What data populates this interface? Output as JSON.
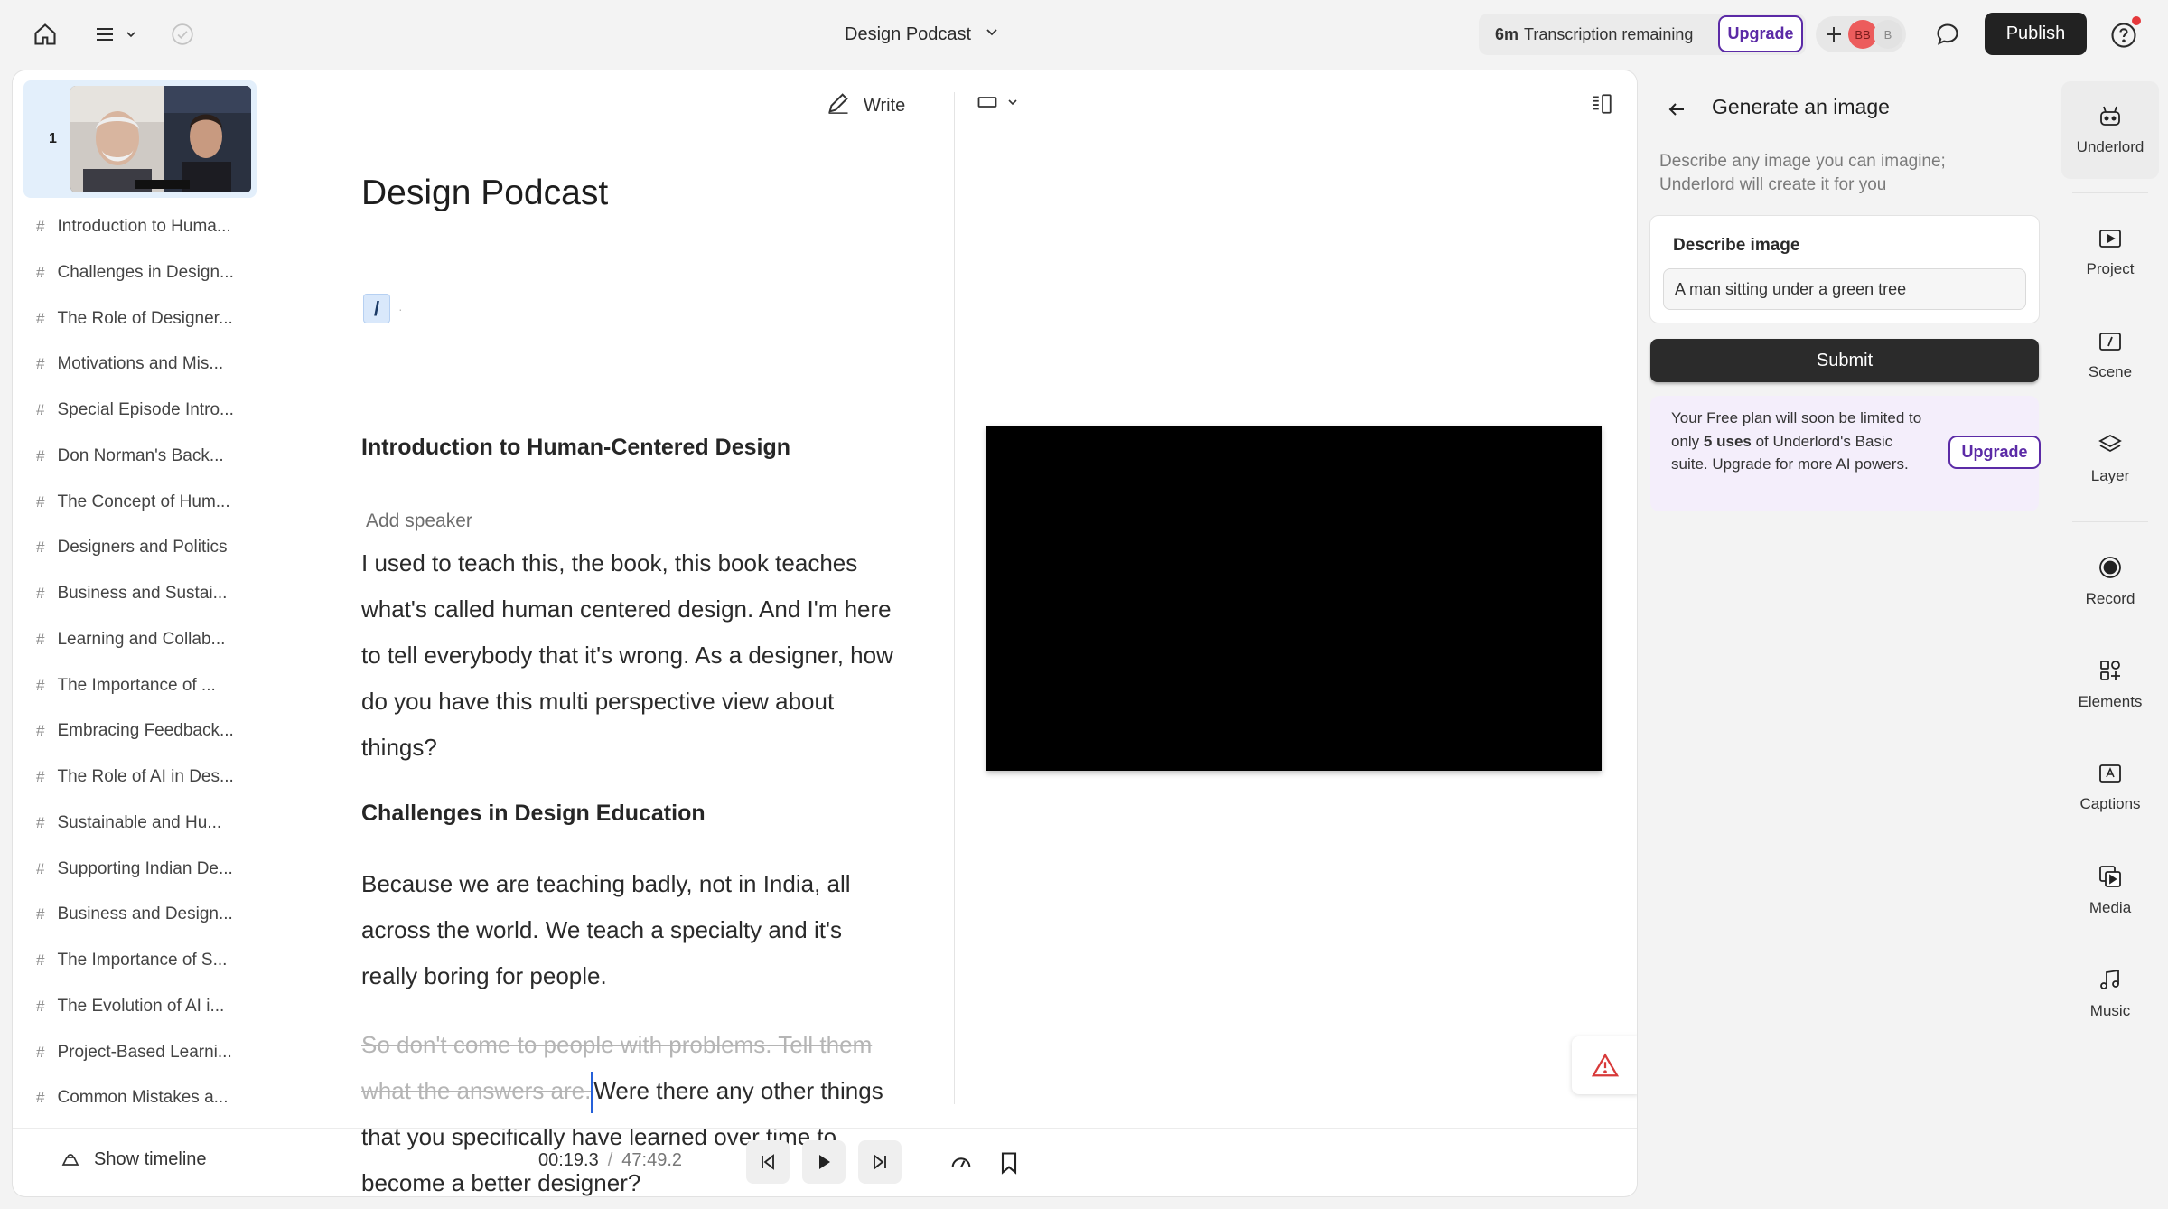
{
  "topbar": {
    "doc_title": "Design Podcast",
    "transcription_amount": "6m",
    "transcription_label": "Transcription remaining",
    "upgrade_label": "Upgrade",
    "avatar_initials_1": "BB",
    "avatar_initials_2": "B",
    "publish_label": "Publish"
  },
  "chapters": {
    "thumb_number": "1",
    "items": [
      "Introduction to Huma...",
      "Challenges in Design...",
      "The Role of Designer...",
      "Motivations and Mis...",
      "Special Episode Intro...",
      "Don Norman's Back...",
      "The Concept of Hum...",
      "Designers and Politics",
      "Business and Sustai...",
      "Learning and Collab...",
      "The Importance of ...",
      "Embracing Feedback...",
      "The Role of AI in Des...",
      "Sustainable and Hu...",
      "Supporting Indian De...",
      "Business and Design...",
      "The Importance of S...",
      "The Evolution of AI i...",
      "Project-Based Learni...",
      "Common Mistakes a..."
    ]
  },
  "script": {
    "write_label": "Write",
    "title": "Design Podcast",
    "slash": "/",
    "heading_1": "Introduction to Human-Centered Design",
    "add_speaker": "Add speaker",
    "para_1": "I used to teach this, the book, this book teaches what's called human centered design. And I'm here to tell everybody that it's wrong. As a designer, how do you have this multi perspective view about things?",
    "heading_2": "Challenges in Design Education",
    "para_2": "Because we are teaching badly, not in India, all across the world. We teach a specialty and it's really boring for people.",
    "para_3_struck": "So don't come to people with problems. Tell them what the answers are.",
    "para_3_rest": "Were there any other things that you specifically have learned over time to become a better designer?"
  },
  "player": {
    "show_timeline_label": "Show timeline",
    "current_time": "00:19.3",
    "separator": "/",
    "total_time": "47:49.2"
  },
  "panel": {
    "title": "Generate an image",
    "description": "Describe any image you can imagine; Underlord will create it for you",
    "describe_label": "Describe image",
    "describe_value": "A man sitting under a green tree",
    "submit_label": "Submit",
    "plan_text_1": "Your Free plan will soon be limited to only ",
    "plan_text_bold": "5 uses",
    "plan_text_2": " of Underlord's Basic suite. Upgrade for more AI powers.",
    "upgrade_label": "Upgrade"
  },
  "rail": {
    "items": [
      "Underlord",
      "Project",
      "Scene",
      "Layer",
      "Record",
      "Elements",
      "Captions",
      "Media",
      "Music"
    ]
  },
  "colors": {
    "accent_purple": "#5b2aa6",
    "cursor_blue": "#2560d9",
    "notification_red": "#e5383b"
  }
}
